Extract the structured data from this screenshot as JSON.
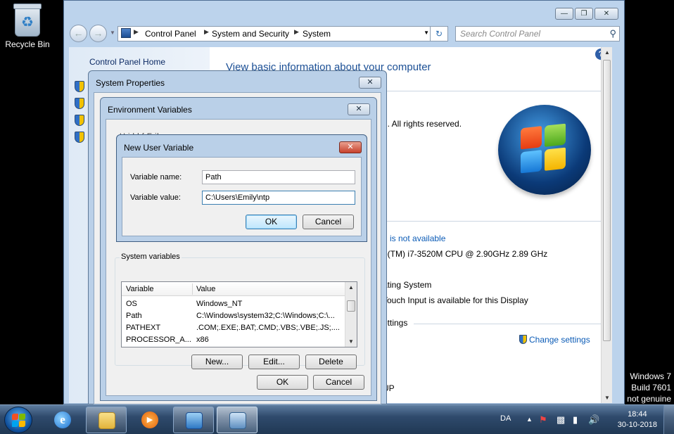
{
  "desktop": {
    "recycle_bin_label": "Recycle Bin",
    "watermark": [
      "Windows 7",
      "Build 7601",
      "not genuine"
    ]
  },
  "explorer": {
    "window_controls": {
      "minimize": "—",
      "maximize": "❐",
      "close": "✕"
    },
    "breadcrumbs": [
      "Control Panel",
      "System and Security",
      "System"
    ],
    "search_placeholder": "Search Control Panel",
    "left_pane": {
      "home_link": "Control Panel Home"
    },
    "content": {
      "heading": "View basic information about your computer",
      "copyright_fragment": "n.  All rights reserved.",
      "rating_fragment": "g is not available",
      "processor_fragment": "e(TM) i7-3520M CPU @ 2.90GHz   2.89 GHz",
      "system_type_fragment": "ating System",
      "pen_touch_fragment": "Touch Input is available for this Display",
      "settings_fragment": "ettings",
      "change_settings_link": "Change settings",
      "workgroup_fragment": "UP"
    },
    "help_icon": "?"
  },
  "system_properties": {
    "title": "System Properties",
    "close": "✕"
  },
  "environment_variables": {
    "title": "Environment Variables",
    "close": "✕",
    "user_vars_fragment": "U    i  bl    f   E il",
    "system_variables_label": "System variables",
    "columns": [
      "Variable",
      "Value"
    ],
    "rows": [
      {
        "variable": "OS",
        "value": "Windows_NT"
      },
      {
        "variable": "Path",
        "value": "C:\\Windows\\system32;C:\\Windows;C:\\..."
      },
      {
        "variable": "PATHEXT",
        "value": ".COM;.EXE;.BAT;.CMD;.VBS;.VBE;.JS;...."
      },
      {
        "variable": "PROCESSOR_A...",
        "value": "x86"
      }
    ],
    "buttons": {
      "new": "New...",
      "edit": "Edit...",
      "delete": "Delete",
      "ok": "OK",
      "cancel": "Cancel"
    }
  },
  "new_user_variable": {
    "title": "New User Variable",
    "close": "✕",
    "name_label": "Variable name:",
    "name_value": "Path",
    "value_label": "Variable value:",
    "value_value": "C:\\Users\\Emily\\ntp",
    "ok": "OK",
    "cancel": "Cancel"
  },
  "taskbar": {
    "language": "DA",
    "time": "18:44",
    "date": "30-10-2018"
  },
  "colors": {
    "accent_link": "#0b5bb6",
    "heading": "#1b4f95",
    "dialog_frame": "#bad0e8",
    "taskbar": "#203854"
  }
}
